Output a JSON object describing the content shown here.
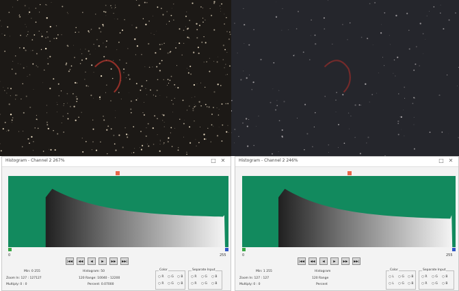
{
  "photos": {
    "left": {
      "palette": {
        "background": "#1c1916",
        "star": "#f0e2c8",
        "nebula": "#b8372f"
      }
    },
    "right": {
      "palette": {
        "background": "#25262c",
        "star": "#a9a5a8",
        "nebula": "#8e2c2a"
      }
    }
  },
  "colors": {
    "histogram_bg": "#128a5e",
    "pointer": "#e8674a",
    "black_handle": "#38a845",
    "white_handle": "#2f56c6",
    "panel_bg": "#f3f3f3"
  },
  "panels": [
    {
      "title": "Histogram - Channel 2 267%",
      "axis_min": "0",
      "axis_max": "255",
      "histogram_ratio": 0.56,
      "tool_buttons": [
        "|◀◀",
        "◀◀",
        "◀",
        "▶",
        "▶▶",
        "▶▶|"
      ],
      "stats": {
        "min_max": "Min: 0  255",
        "zoom": "Zoom In: 127 : 127127",
        "multiply": "Multiply: 0 : 0",
        "histogram": "Histogram: 50",
        "histogram_range": "120 Range: 10040 - 12200",
        "percent": "Percent: 0.07000"
      },
      "color_group": {
        "label": "Color",
        "options": [
          "R",
          "G",
          "B",
          "R",
          "G",
          "B"
        ]
      },
      "separate_group": {
        "label": "Separate Input",
        "options": [
          "R",
          "G",
          "B",
          "R",
          "G",
          "B"
        ]
      }
    },
    {
      "title": "Histogram - Channel 2 246%",
      "axis_min": "0",
      "axis_max": "255",
      "histogram_ratio": 0.6,
      "tool_buttons": [
        "|◀◀",
        "◀◀",
        "◀",
        "▶",
        "▶▶",
        "▶▶|"
      ],
      "stats": {
        "min_max": "Min: 1  255",
        "zoom": "Zoom In: 127 : 127",
        "multiply": "Multiply: 0 : 0",
        "histogram": "Histogram",
        "histogram_range": "120 Range",
        "percent": "Percent"
      },
      "color_group": {
        "label": "Color",
        "options": [
          "L",
          "G",
          "B",
          "L",
          "G",
          "B"
        ]
      },
      "separate_group": {
        "label": "Separate Input",
        "options": [
          "R",
          "G",
          "B",
          "R",
          "G",
          "B"
        ]
      }
    }
  ]
}
